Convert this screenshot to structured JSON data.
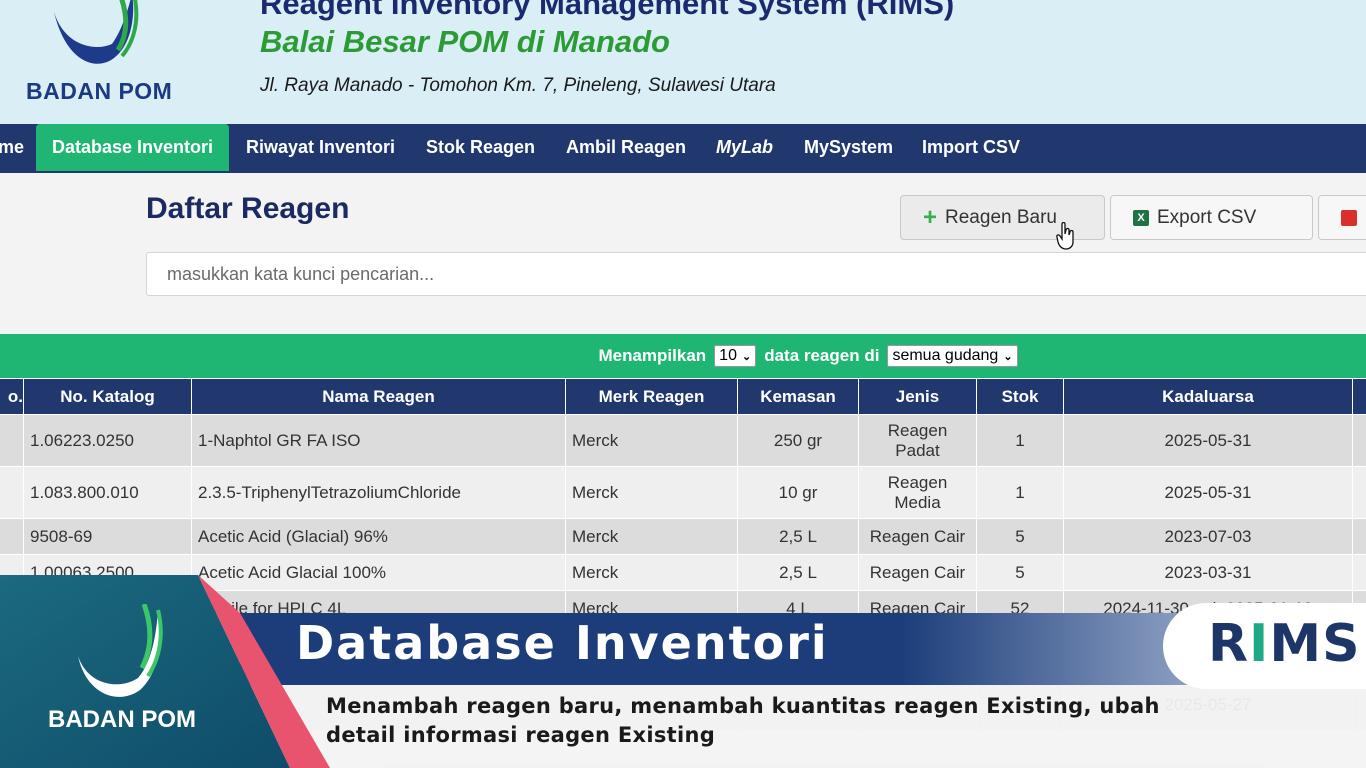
{
  "header": {
    "brand": "BADAN POM",
    "title": "Reagent Inventory Management System (RIMS)",
    "subtitle": "Balai Besar POM di Manado",
    "address": "Jl. Raya Manado - Tomohon Km. 7, Pineleng, Sulawesi Utara"
  },
  "nav": {
    "items": [
      "me",
      "Database Inventori",
      "Riwayat Inventori",
      "Stok Reagen",
      "Ambil Reagen",
      "MyLab",
      "MySystem",
      "Import CSV"
    ],
    "active": "Database Inventori"
  },
  "main": {
    "title": "Daftar Reagen",
    "buttons": {
      "new_label": "Reagen Baru",
      "export_label": "Export CSV"
    },
    "search_placeholder": "masukkan kata kunci pencarian..."
  },
  "filter": {
    "prefix": "Menampilkan",
    "count_value": "10",
    "middle": "data reagen di",
    "location_value": "semua gudang"
  },
  "table": {
    "headers": [
      "o.",
      "No. Katalog",
      "Nama Reagen",
      "Merk Reagen",
      "Kemasan",
      "Jenis",
      "Stok",
      "Kadaluarsa"
    ],
    "rows": [
      {
        "no": "",
        "katalog": "1.06223.0250",
        "nama": "1-Naphtol GR FA ISO",
        "merk": "Merck",
        "kemasan": "250 gr",
        "jenis": "Reagen Padat",
        "stok": "1",
        "kadaluarsa": "2025-05-31"
      },
      {
        "no": "",
        "katalog": "1.083.800.010",
        "nama": "2.3.5-TriphenylTetrazoliumChloride",
        "merk": "Merck",
        "kemasan": "10 gr",
        "jenis": "Reagen Media",
        "stok": "1",
        "kadaluarsa": "2025-05-31"
      },
      {
        "no": "",
        "katalog": "9508-69",
        "nama": "Acetic Acid (Glacial) 96%",
        "merk": "Merck",
        "kemasan": "2,5 L",
        "jenis": "Reagen Cair",
        "stok": "5",
        "kadaluarsa": "2023-07-03"
      },
      {
        "no": "",
        "katalog": "1.00063.2500",
        "nama": "Acetic Acid Glacial 100%",
        "merk": "Merck",
        "kemasan": "2,5 L",
        "jenis": "Reagen Cair",
        "stok": "5",
        "kadaluarsa": "2023-03-31"
      },
      {
        "no": "",
        "katalog": "",
        "nama": "onitrile for HPLC 4L",
        "merk": "Merck",
        "kemasan": "4 L",
        "jenis": "Reagen Cair",
        "stok": "52",
        "kadaluarsa": "2024-11-30 s.d. 2025-01-12"
      },
      {
        "no": "",
        "katalog": "",
        "nama": "",
        "merk": "",
        "kemasan": "",
        "jenis": "",
        "stok": "",
        "kadaluarsa": ""
      },
      {
        "no": "",
        "katalog": "",
        "nama": "",
        "merk": "",
        "kemasan": "",
        "jenis": "",
        "stok": "",
        "kadaluarsa": "2025-05-27"
      }
    ]
  },
  "overlay": {
    "title": "Database Inventori",
    "description": "Menambah reagen baru, menambah kuantitas reagen Existing, ubah detail informasi reagen Existing",
    "brand": "BADAN POM",
    "badge_letters": [
      "R",
      "I",
      "MS"
    ]
  },
  "colors": {
    "nav_bg": "#21386f",
    "accent_green": "#1fb674",
    "header_bg": "#d9eef5",
    "banner_blue": "#1c3d7a",
    "stripe_pink": "#e8546d"
  },
  "icons": [
    "plus-icon",
    "excel-icon",
    "delete-icon",
    "mouse-cursor-icon",
    "chevron-down-icon"
  ]
}
